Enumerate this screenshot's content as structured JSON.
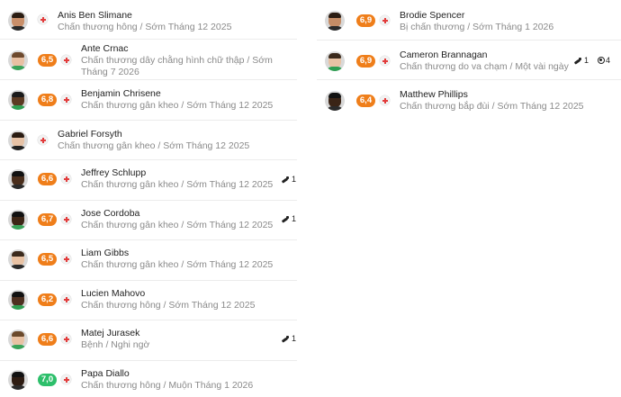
{
  "colors": {
    "rating_orange": "#ef7e1a",
    "rating_green": "#2dbf6b",
    "medical_cross": "#e23b3b"
  },
  "left_column": [
    {
      "name": "Anis Ben Slimane",
      "rating": "",
      "desc": "Chấn thương hông / Sớm Tháng 12 2025",
      "stats": []
    },
    {
      "name": "Ante Crnac",
      "rating": "6,5",
      "rating_color": "orange",
      "desc": "Chấn thương dây chằng hình chữ thập / Sớm Tháng 7 2026",
      "stats": []
    },
    {
      "name": "Benjamin Chrisene",
      "rating": "6,8",
      "rating_color": "orange",
      "desc": "Chấn thương gân kheo / Sớm Tháng 12 2025",
      "stats": []
    },
    {
      "name": "Gabriel Forsyth",
      "rating": "",
      "desc": "Chấn thương gân kheo / Sớm Tháng 12 2025",
      "stats": []
    },
    {
      "name": "Jeffrey Schlupp",
      "rating": "6,6",
      "rating_color": "orange",
      "desc": "Chấn thương gân kheo / Sớm Tháng 12 2025",
      "stats": [
        {
          "icon": "assist-boot-icon",
          "count": "1"
        }
      ]
    },
    {
      "name": "Jose Cordoba",
      "rating": "6,7",
      "rating_color": "orange",
      "desc": "Chấn thương gân kheo / Sớm Tháng 12 2025",
      "stats": [
        {
          "icon": "assist-boot-icon",
          "count": "1"
        }
      ]
    },
    {
      "name": "Liam Gibbs",
      "rating": "6,5",
      "rating_color": "orange",
      "desc": "Chấn thương gân kheo / Sớm Tháng 12 2025",
      "stats": []
    },
    {
      "name": "Lucien Mahovo",
      "rating": "6,2",
      "rating_color": "orange",
      "desc": "Chấn thương hông / Sớm Tháng 12 2025",
      "stats": []
    },
    {
      "name": "Matej Jurasek",
      "rating": "6,6",
      "rating_color": "orange",
      "desc": "Bệnh / Nghi ngờ",
      "stats": [
        {
          "icon": "assist-boot-icon",
          "count": "1"
        }
      ]
    },
    {
      "name": "Papa Diallo",
      "rating": "7,0",
      "rating_color": "green",
      "desc": "Chấn thương hông / Muộn Tháng 1 2026",
      "stats": []
    }
  ],
  "right_column": [
    {
      "name": "Brodie Spencer",
      "rating": "6,9",
      "rating_color": "orange",
      "desc": "Bị chấn thương / Sớm Tháng 1 2026",
      "stats": []
    },
    {
      "name": "Cameron Brannagan",
      "rating": "6,9",
      "rating_color": "orange",
      "desc": "Chấn thương do va chạm / Một vài ngày",
      "stats": [
        {
          "icon": "assist-boot-icon",
          "count": "1"
        },
        {
          "icon": "goal-ball-icon",
          "count": "4"
        }
      ]
    },
    {
      "name": "Matthew Phillips",
      "rating": "6,4",
      "rating_color": "orange",
      "desc": "Chấn thương bắp đùi / Sớm Tháng 12 2025",
      "stats": []
    }
  ]
}
